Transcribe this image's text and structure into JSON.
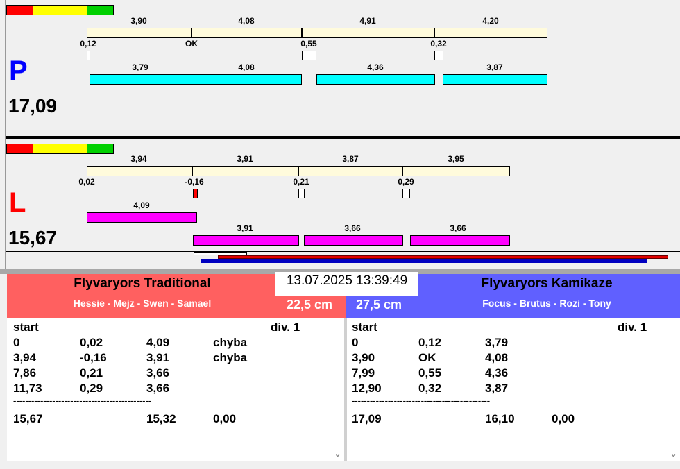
{
  "colors": {
    "red": "#ff0000",
    "yellow": "#ffff00",
    "green": "#00d000",
    "team_left": "#ff6060",
    "team_right": "#6060ff"
  },
  "top": {
    "letter": "P",
    "total": "17,09",
    "segments": [
      "3,90",
      "4,08",
      "4,91",
      "4,20"
    ],
    "checks": [
      "0,12",
      "OK",
      "0,55",
      "0,32"
    ],
    "bars": [
      "3,79",
      "4,08",
      "4,36",
      "3,87"
    ]
  },
  "bottom": {
    "letter": "L",
    "total": "15,67",
    "segments": [
      "3,94",
      "3,91",
      "3,87",
      "3,95"
    ],
    "checks": [
      "0,02",
      "-0,16",
      "0,21",
      "0,29"
    ],
    "bars": [
      "4,09",
      "3,91",
      "3,66",
      "3,66"
    ]
  },
  "datetime": "13.07.2025 13:39:49",
  "left_team": {
    "name": "Flyvaryors Traditional",
    "members": "Hessie - Mejz - Swen - Samael",
    "size": "22,5 cm",
    "header": "start",
    "div": "div. 1",
    "rows": [
      [
        "0",
        "0,02",
        "4,09",
        "chyba"
      ],
      [
        "3,94",
        "-0,16",
        "3,91",
        "chyba"
      ],
      [
        "7,86",
        "0,21",
        "3,66",
        ""
      ],
      [
        "11,73",
        "0,29",
        "3,66",
        ""
      ]
    ],
    "separator": "----------------------------------------------",
    "totals": [
      "15,67",
      "15,32",
      "0,00"
    ]
  },
  "right_team": {
    "name": "Flyvaryors Kamikaze",
    "members": "Focus - Brutus - Rozi - Tony",
    "size": "27,5 cm",
    "header": "start",
    "div": "div. 1",
    "rows": [
      [
        "0",
        "0,12",
        "3,79",
        ""
      ],
      [
        "3,90",
        "OK",
        "4,08",
        ""
      ],
      [
        "7,99",
        "0,55",
        "4,36",
        ""
      ],
      [
        "12,90",
        "0,32",
        "3,87",
        ""
      ]
    ],
    "separator": "----------------------------------------------",
    "totals": [
      "17,09",
      "16,10",
      "0,00"
    ]
  }
}
